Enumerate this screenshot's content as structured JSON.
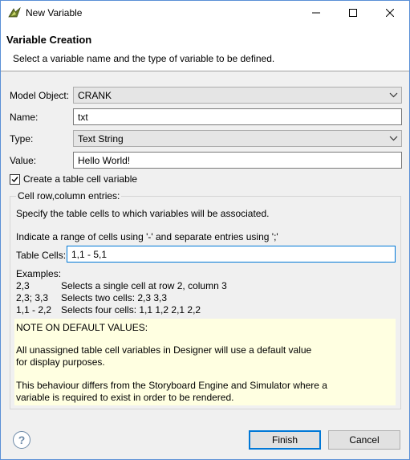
{
  "window": {
    "title": "New Variable",
    "minimize_glyph": "—",
    "maximize_glyph": "☐",
    "close_glyph": "✕"
  },
  "banner": {
    "title": "Variable Creation",
    "description": "Select a variable name and the type of variable to be defined."
  },
  "form": {
    "model_object_label": "Model Object:",
    "model_object_value": "CRANK",
    "name_label": "Name:",
    "name_value": "txt",
    "type_label": "Type:",
    "type_value": "Text String",
    "value_label": "Value:",
    "value_value": "Hello World!",
    "table_cell_checkbox_label": "Create a table cell variable",
    "table_cell_checked": true
  },
  "group": {
    "legend": "Cell row,column entries:",
    "specify_text": "Specify the table cells to which variables will be associated.",
    "range_text": "Indicate a range of cells using '-' and separate entries using ';'",
    "table_cells_label": "Table Cells:",
    "table_cells_value": "1,1 - 5,1",
    "examples_heading": "Examples:",
    "examples": [
      {
        "code": "2,3",
        "desc": "Selects a single cell at row 2, column 3"
      },
      {
        "code": "2,3; 3,3",
        "desc": "Selects two cells: 2,3 3,3"
      },
      {
        "code": "1,1 - 2,2",
        "desc": "Selects four cells: 1,1 1,2 2,1 2,2"
      }
    ],
    "note": {
      "heading": "NOTE ON DEFAULT VALUES:",
      "line1": "All unassigned table cell variables in Designer will use a default value",
      "line2": "for display purposes.",
      "line3": "This behaviour differs from the Storyboard Engine and Simulator where a",
      "line4": "variable is required to exist in order to be rendered."
    }
  },
  "footer": {
    "help_glyph": "?",
    "finish_label": "Finish",
    "cancel_label": "Cancel"
  },
  "colors": {
    "accent": "#0078d7",
    "note_background": "#ffffe1",
    "dialog_background": "#f0f0f0"
  }
}
